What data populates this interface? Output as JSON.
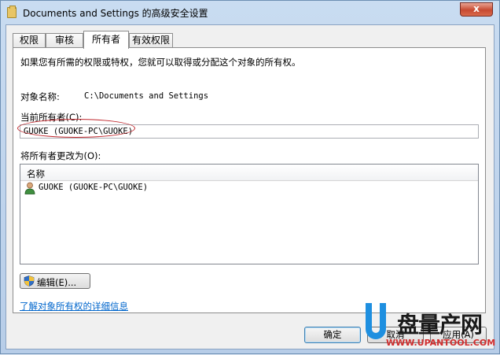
{
  "window": {
    "title": "Documents and Settings 的高级安全设置",
    "close_label": "x"
  },
  "tabs": [
    {
      "label": "权限",
      "active": false
    },
    {
      "label": "审核",
      "active": false
    },
    {
      "label": "所有者",
      "active": true
    },
    {
      "label": "有效权限",
      "active": false
    }
  ],
  "owner_tab": {
    "description": "如果您有所需的权限或特权，您就可以取得或分配这个对象的所有权。",
    "object_name_label": "对象名称:",
    "object_name_value": "C:\\Documents and Settings",
    "current_owner_label": "当前所有者(C):",
    "current_owner_value": "GUOKE (GUOKE-PC\\GUOKE)",
    "change_owner_label": "将所有者更改为(O):",
    "list_column_name": "名称",
    "list_items": [
      "GUOKE (GUOKE-PC\\GUOKE)"
    ],
    "edit_button": "编辑(E)...",
    "details_link": "了解对象所有权的详细信息"
  },
  "footer": {
    "ok_button": "确定",
    "cancel_button": "取消",
    "apply_button": "应用(A)"
  },
  "watermark": {
    "brand_cn": "盘量产网",
    "url": "WWW.UPANTOOL.COM"
  },
  "colors": {
    "link": "#0066cc",
    "highlight_ellipse": "#c0272d",
    "watermark_blue": "#1e8fe0",
    "watermark_red": "#d12e2e"
  }
}
